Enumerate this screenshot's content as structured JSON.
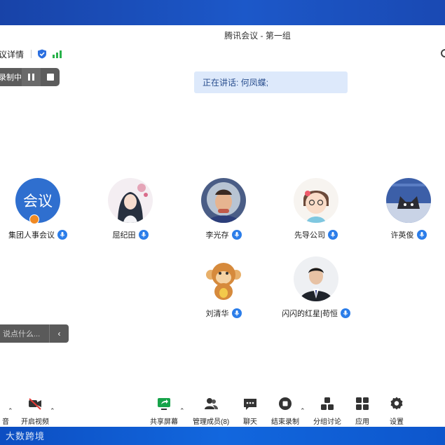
{
  "window": {
    "title": "腾讯会议 - 第一组"
  },
  "infobar": {
    "meeting_info": "议详情"
  },
  "recording": {
    "label": "录制中"
  },
  "speaking": {
    "text": "正在讲话: 何凤蝶;"
  },
  "participants": [
    {
      "name": "集团人事会议",
      "avatar_text": "会议",
      "host": true
    },
    {
      "name": "屈纪田"
    },
    {
      "name": "李光存"
    },
    {
      "name": "先导公司"
    },
    {
      "name": "许英俊"
    },
    {
      "name": "刘清华"
    },
    {
      "name": "闪闪的红星|苟恒"
    }
  ],
  "chat": {
    "placeholder": "说点什么...",
    "toggle": "‹"
  },
  "toolbar": {
    "mute": "音",
    "video": "开启视频",
    "share": "共享屏幕",
    "members": "管理成员(8)",
    "chat": "聊天",
    "end_record": "结束录制",
    "breakout": "分组讨论",
    "apps": "应用",
    "settings": "设置"
  },
  "watermark": {
    "text": "大数跨境"
  },
  "colors": {
    "accent": "#2b7de9",
    "signal": "#28b24a",
    "share_green": "#17a34a",
    "taskbar": "#1267de"
  }
}
